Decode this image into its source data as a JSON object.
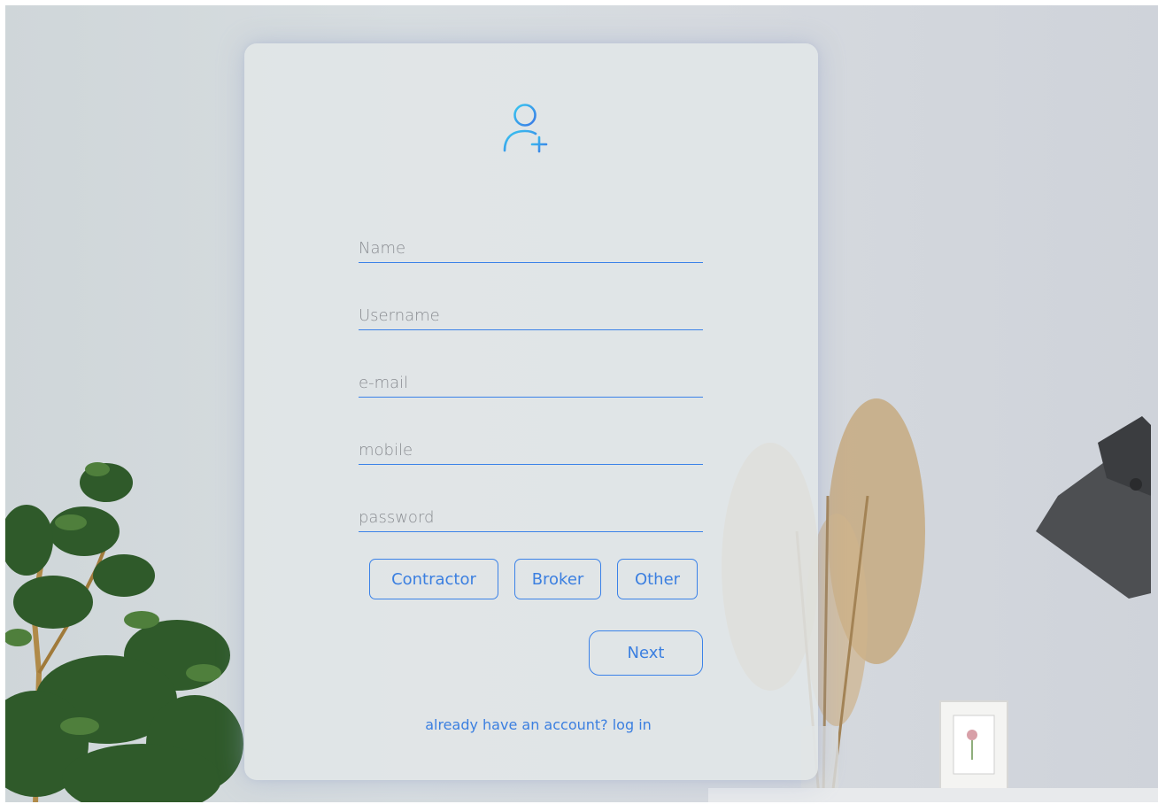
{
  "form": {
    "fields": [
      {
        "name": "name",
        "placeholder": "Name",
        "value": ""
      },
      {
        "name": "username",
        "placeholder": "Username",
        "value": ""
      },
      {
        "name": "email",
        "placeholder": "e-mail",
        "value": ""
      },
      {
        "name": "mobile",
        "placeholder": "mobile",
        "value": ""
      },
      {
        "name": "password",
        "placeholder": "password",
        "value": ""
      }
    ],
    "roles": [
      "Contractor",
      "Broker",
      "Other"
    ],
    "next_label": "Next",
    "login_link": "already have an account? log in"
  },
  "icons": {
    "header": "add-user-icon"
  },
  "colors": {
    "accent": "#3b82e8",
    "icon_gradient_start": "#39c8f0",
    "icon_gradient_end": "#3a78e6",
    "card": "#e2e6e8",
    "wall": "#d4dadd"
  }
}
